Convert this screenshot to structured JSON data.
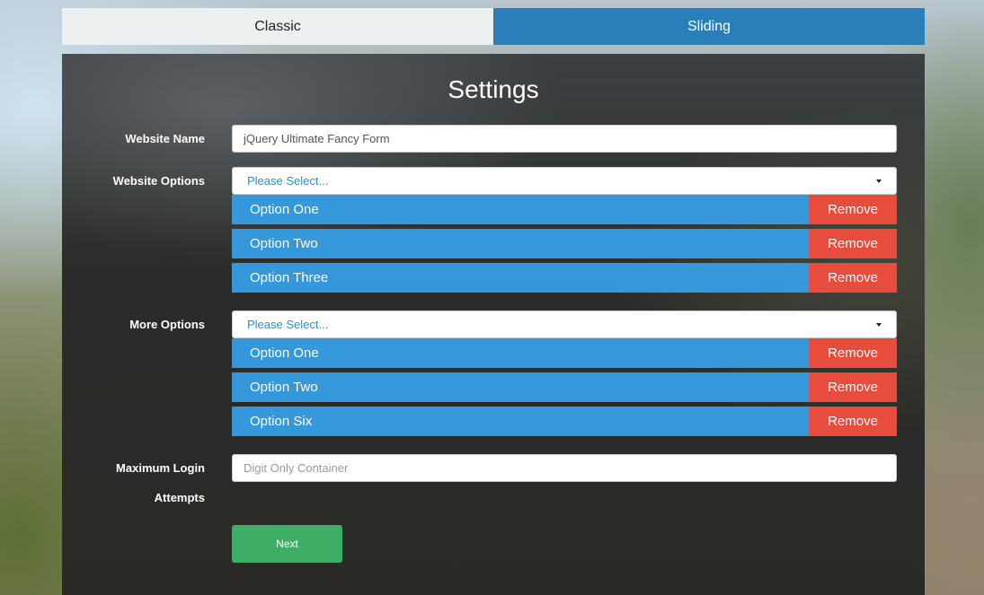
{
  "tabs": {
    "classic": "Classic",
    "sliding": "Sliding"
  },
  "title": "Settings",
  "website_name": {
    "label": "Website Name",
    "value": "jQuery Ultimate Fancy Form"
  },
  "website_options": {
    "label": "Website Options",
    "placeholder": "Please Select...",
    "items": [
      {
        "label": "Option One",
        "remove": "Remove"
      },
      {
        "label": "Option Two",
        "remove": "Remove"
      },
      {
        "label": "Option Three",
        "remove": "Remove"
      }
    ]
  },
  "more_options": {
    "label": "More Options",
    "placeholder": "Please Select...",
    "items": [
      {
        "label": "Option One",
        "remove": "Remove"
      },
      {
        "label": "Option Two",
        "remove": "Remove"
      },
      {
        "label": "Option Six",
        "remove": "Remove"
      }
    ]
  },
  "max_login": {
    "label_line1": "Maximum Login",
    "label_line2": "Attempts",
    "placeholder": "Digit Only Container"
  },
  "next_button": "Next",
  "colors": {
    "tab_active": "#2980b9",
    "option": "#3498db",
    "remove": "#e74c3c",
    "next": "#3eae66"
  },
  "icons": {
    "select_caret": "caret-down-icon"
  }
}
